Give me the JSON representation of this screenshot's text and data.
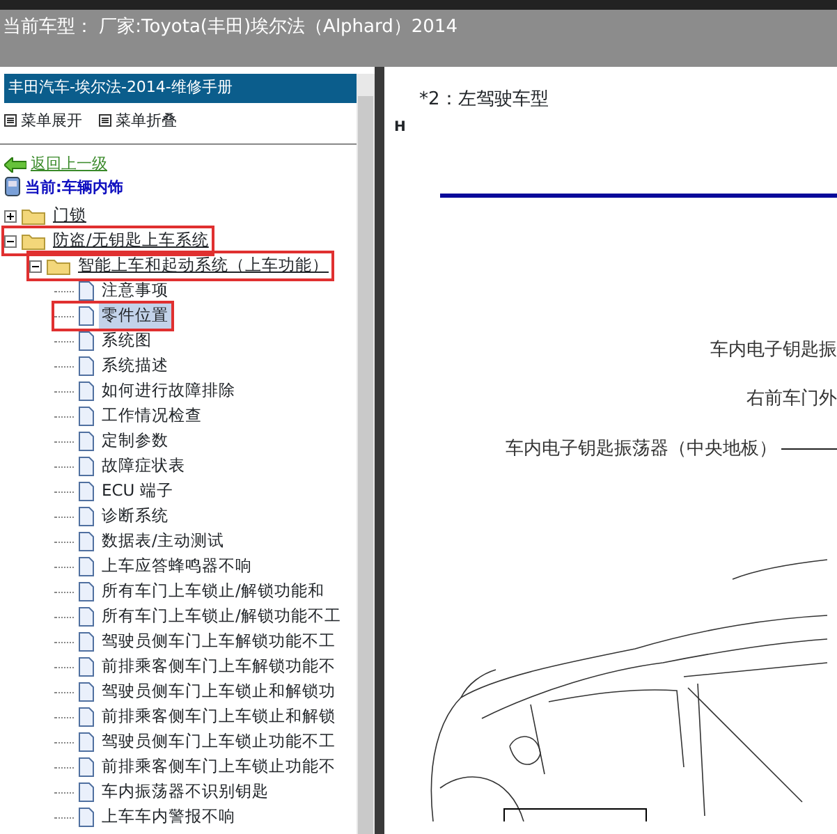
{
  "header": {
    "title": "当前车型：  厂家:Toyota(丰田)埃尔法（Alphard）2014"
  },
  "sidebar": {
    "title": "丰田汽车-埃尔法-2014-维修手册",
    "actions": [
      "菜单展开",
      "菜单折叠"
    ],
    "back_link": "返回上一级",
    "current": "当前:车辆内饰",
    "tree": [
      {
        "label": "门锁",
        "expanded": false,
        "highlighted": false,
        "selected": false
      },
      {
        "label": "防盗/无钥匙上车系统",
        "expanded": true,
        "highlighted": true,
        "selected": false,
        "children": [
          {
            "label": "智能上车和起动系统（上车功能）",
            "expanded": true,
            "highlighted": true,
            "selected": false,
            "children": [
              {
                "label": "注意事项",
                "highlighted": false,
                "selected": false
              },
              {
                "label": "零件位置",
                "highlighted": true,
                "selected": true
              },
              {
                "label": "系统图",
                "highlighted": false,
                "selected": false
              },
              {
                "label": "系统描述",
                "highlighted": false,
                "selected": false
              },
              {
                "label": "如何进行故障排除",
                "highlighted": false,
                "selected": false
              },
              {
                "label": "工作情况检查",
                "highlighted": false,
                "selected": false
              },
              {
                "label": "定制参数",
                "highlighted": false,
                "selected": false
              },
              {
                "label": "故障症状表",
                "highlighted": false,
                "selected": false
              },
              {
                "label": "ECU 端子",
                "highlighted": false,
                "selected": false
              },
              {
                "label": "诊断系统",
                "highlighted": false,
                "selected": false
              },
              {
                "label": "数据表/主动测试",
                "highlighted": false,
                "selected": false
              },
              {
                "label": "上车应答蜂鸣器不响",
                "highlighted": false,
                "selected": false
              },
              {
                "label": "所有车门上车锁止/解锁功能和",
                "highlighted": false,
                "selected": false
              },
              {
                "label": "所有车门上车锁止/解锁功能不工",
                "highlighted": false,
                "selected": false
              },
              {
                "label": "驾驶员侧车门上车解锁功能不工",
                "highlighted": false,
                "selected": false
              },
              {
                "label": "前排乘客侧车门上车解锁功能不",
                "highlighted": false,
                "selected": false
              },
              {
                "label": "驾驶员侧车门上车锁止和解锁功",
                "highlighted": false,
                "selected": false
              },
              {
                "label": "前排乘客侧车门上车锁止和解锁",
                "highlighted": false,
                "selected": false
              },
              {
                "label": "驾驶员侧车门上车锁止功能不工",
                "highlighted": false,
                "selected": false
              },
              {
                "label": "前排乘客侧车门上车锁止功能不",
                "highlighted": false,
                "selected": false
              },
              {
                "label": "车内振荡器不识别钥匙",
                "highlighted": false,
                "selected": false
              },
              {
                "label": "上车车内警报不响",
                "highlighted": false,
                "selected": false
              }
            ]
          }
        ]
      }
    ]
  },
  "document": {
    "caption": "*2：左驾驶车型",
    "marker": "H",
    "labels": [
      "车内电子钥匙振",
      "右前车门外",
      "车内电子钥匙振荡器（中央地板）"
    ]
  }
}
